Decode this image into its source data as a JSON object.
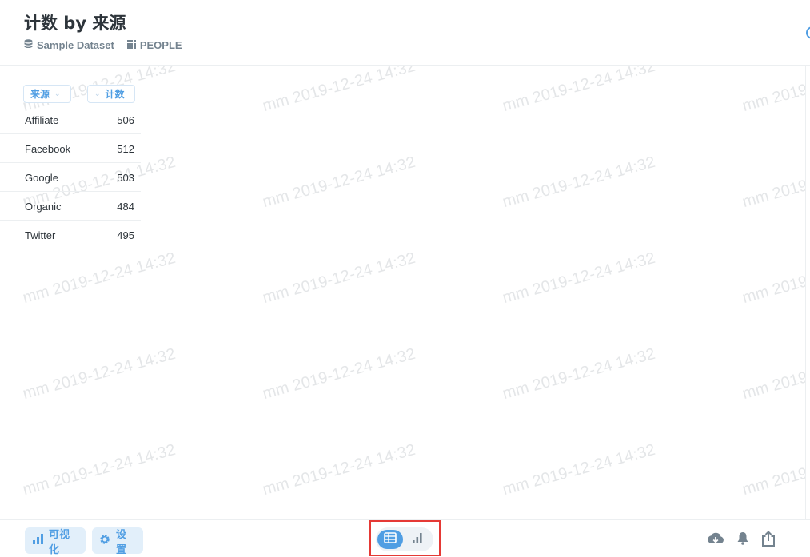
{
  "header": {
    "title": "计数 by 来源",
    "breadcrumbs": [
      {
        "label": "Sample Dataset",
        "icon": "database-icon"
      },
      {
        "label": "PEOPLE",
        "icon": "grid-icon"
      }
    ]
  },
  "table": {
    "columns": [
      {
        "label": "来源"
      },
      {
        "label": "计数"
      }
    ],
    "rows": [
      {
        "source": "Affiliate",
        "count": "506"
      },
      {
        "source": "Facebook",
        "count": "512"
      },
      {
        "source": "Google",
        "count": "503"
      },
      {
        "source": "Organic",
        "count": "484"
      },
      {
        "source": "Twitter",
        "count": "495"
      }
    ]
  },
  "watermark": {
    "text": "mm 2019-12-24 14:32"
  },
  "footer": {
    "visualize_label": "可视化",
    "settings_label": "设置",
    "view_toggle": {
      "selected": "table",
      "options": [
        "table-icon",
        "bar-chart-icon"
      ]
    },
    "actions": [
      "download-icon",
      "bell-icon",
      "share-icon"
    ]
  },
  "colors": {
    "accent": "#509ee3",
    "highlight_border": "#e53935",
    "text": "#2e353b",
    "muted": "#74838f"
  }
}
